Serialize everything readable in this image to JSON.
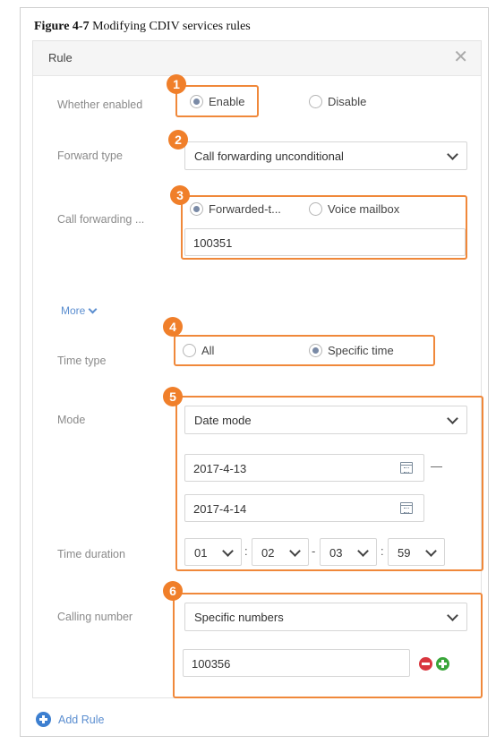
{
  "figure": {
    "number": "Figure 4-7",
    "caption": "Modifying CDIV services rules"
  },
  "dialog": {
    "title": "Rule",
    "close_icon": "close-icon"
  },
  "fields": {
    "whether_enabled": {
      "label": "Whether enabled",
      "options": [
        "Enable",
        "Disable"
      ],
      "selected": "Enable"
    },
    "forward_type": {
      "label": "Forward type",
      "value": "Call forwarding unconditional"
    },
    "call_forwarding": {
      "label": "Call forwarding ...",
      "options": [
        "Forwarded-t...",
        "Voice mailbox"
      ],
      "selected": "Forwarded-t...",
      "number": "100351"
    },
    "more": {
      "label": "More"
    },
    "time_type": {
      "label": "Time type",
      "options": [
        "All",
        "Specific time"
      ],
      "selected": "Specific time"
    },
    "mode": {
      "label": "Mode",
      "value": "Date mode",
      "start_date": "2017-4-13",
      "end_date": "2017-4-14",
      "range_separator": "—"
    },
    "time_duration": {
      "label": "Time duration",
      "hours_start": "01",
      "minutes_start": "02",
      "hours_end": "03",
      "minutes_end": "59"
    },
    "calling_number": {
      "label": "Calling number",
      "value": "Specific numbers",
      "number": "100356"
    }
  },
  "badges": [
    "1",
    "2",
    "3",
    "4",
    "5",
    "6"
  ],
  "add_rule": {
    "label": "Add Rule"
  },
  "colors": {
    "highlight": "#f0883a",
    "badge": "#f07f2a",
    "link": "#5b8ed0",
    "remove": "#d9363e",
    "add": "#3aa63a"
  }
}
